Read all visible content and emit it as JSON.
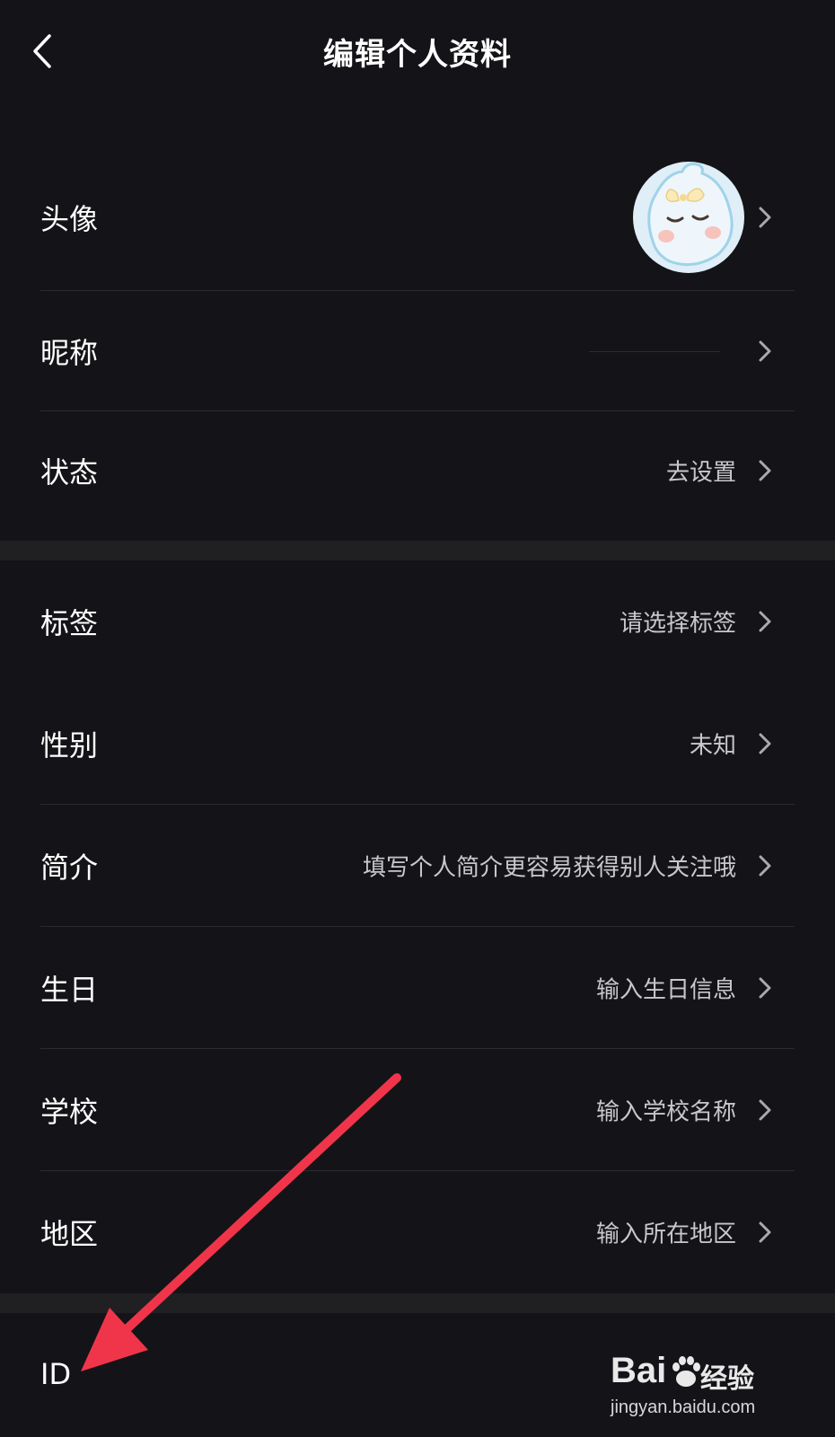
{
  "header": {
    "title": "编辑个人资料",
    "back_icon": "chevron-left-icon"
  },
  "section1": [
    {
      "key": "avatar",
      "label": "头像"
    },
    {
      "key": "nickname",
      "label": "昵称",
      "value": ""
    },
    {
      "key": "status",
      "label": "状态",
      "value": "去设置"
    }
  ],
  "section2": [
    {
      "key": "tags",
      "label": "标签",
      "value": "请选择标签"
    },
    {
      "key": "gender",
      "label": "性别",
      "value": "未知"
    },
    {
      "key": "bio",
      "label": "简介",
      "value": "填写个人简介更容易获得别人关注哦"
    },
    {
      "key": "birthday",
      "label": "生日",
      "value": "输入生日信息"
    },
    {
      "key": "school",
      "label": "学校",
      "value": "输入学校名称"
    },
    {
      "key": "region",
      "label": "地区",
      "value": "输入所在地区"
    }
  ],
  "section3": [
    {
      "key": "id",
      "label": "ID"
    }
  ],
  "watermark": {
    "logo_text": "Bai",
    "logo_suffix": "经验",
    "url": "jingyan.baidu.com"
  },
  "colors": {
    "background": "#141418",
    "section_gap": "#202023",
    "arrow": "#f0354a",
    "value_text": "#c8c8cc"
  }
}
